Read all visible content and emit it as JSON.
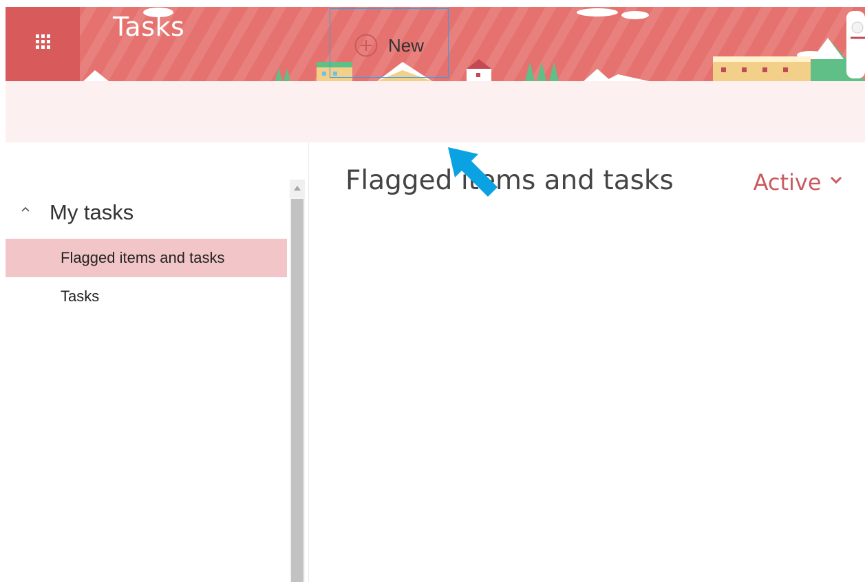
{
  "app": {
    "title": "Tasks"
  },
  "toolbar": {
    "new_label": "New"
  },
  "sidebar": {
    "group_label": "My tasks",
    "items": [
      {
        "label": "Flagged items and tasks",
        "selected": true
      },
      {
        "label": "Tasks",
        "selected": false
      }
    ]
  },
  "main": {
    "title": "Flagged items and tasks",
    "filter_label": "Active"
  },
  "icons": {
    "app_launcher": "waffle-icon",
    "new": "plus-circle-icon",
    "group_toggle": "chevron-up-icon",
    "filter_dropdown": "chevron-down-icon"
  },
  "colors": {
    "header": "#e5726e",
    "waffle_tile": "#d85a5b",
    "command_bar": "#fcf0f0",
    "selected_item": "#f2c6c8",
    "accent": "#c85a5e",
    "focus_outline": "#2aa2ee"
  }
}
